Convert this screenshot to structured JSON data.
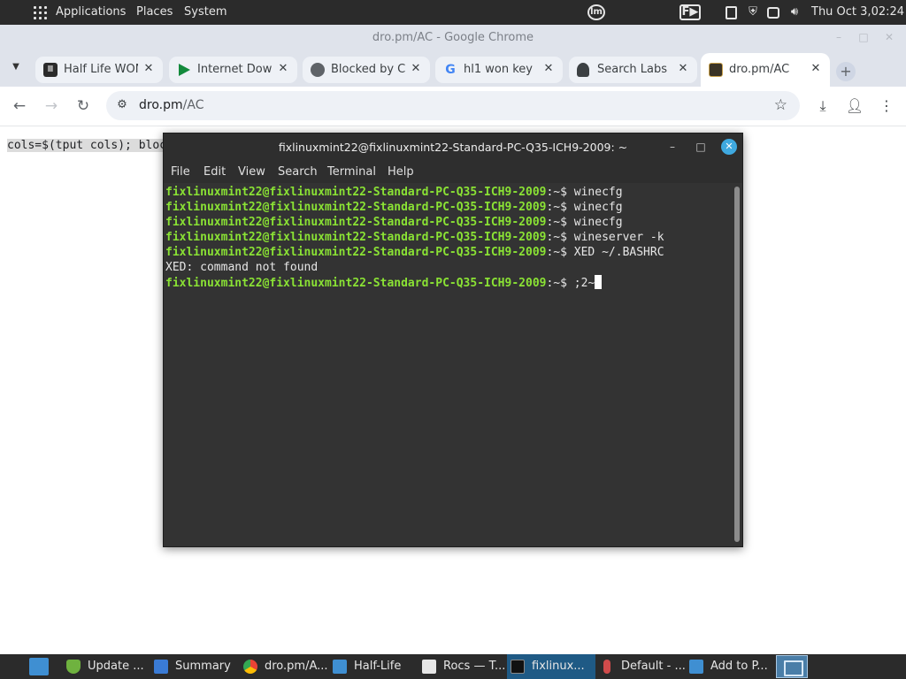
{
  "top_panel": {
    "menus": [
      "Applications",
      "Places",
      "System"
    ],
    "clock": "Thu Oct 3,02:24",
    "icons": [
      "apps-grid-icon",
      "mint-menu-icon",
      "focus-writer-icon",
      "clipboard-icon",
      "shield-icon",
      "window-icon",
      "volume-icon"
    ],
    "mint_glyph": "lm",
    "focus_glyph": "F▶"
  },
  "chrome": {
    "window_title": "dro.pm/AC - Google Chrome",
    "tabs": [
      {
        "title": "Half Life WON",
        "favicon": "hl-icon"
      },
      {
        "title": "Internet Down",
        "favicon": "play-icon"
      },
      {
        "title": "Blocked by C",
        "favicon": "globe-icon"
      },
      {
        "title": "hl1 won key",
        "favicon": "google-icon"
      },
      {
        "title": "Search Labs",
        "favicon": "flask-icon"
      },
      {
        "title": "dro.pm/AC",
        "favicon": "terminal-favicon-icon",
        "active": true
      }
    ],
    "address": {
      "host": "dro.pm",
      "path": "/AC"
    },
    "page_text": "cols=$(tput cols); bloc",
    "accent_color": "#1a73e8"
  },
  "terminal": {
    "title": "fixlinuxmint22@fixlinuxmint22-Standard-PC-Q35-ICH9-2009: ~",
    "menu": [
      "File",
      "Edit",
      "View",
      "Search",
      "Terminal",
      "Help"
    ],
    "prompt": "fixlinuxmint22@fixlinuxmint22-Standard-PC-Q35-ICH9-2009",
    "prompt_suffix": ":~$ ",
    "lines": [
      {
        "type": "cmd",
        "text": "winecfg"
      },
      {
        "type": "cmd",
        "text": "winecfg"
      },
      {
        "type": "cmd",
        "text": "winecfg"
      },
      {
        "type": "cmd",
        "text": "wineserver -k"
      },
      {
        "type": "cmd",
        "text": "XED ~/.BASHRC"
      },
      {
        "type": "out",
        "text": "XED: command not found"
      },
      {
        "type": "cmd",
        "text": ";2~"
      }
    ],
    "prompt_color": "#8ae234"
  },
  "taskbar": {
    "items": [
      {
        "label": "Update ...",
        "icon": "update-manager-icon"
      },
      {
        "label": "Summary",
        "icon": "download-icon"
      },
      {
        "label": "dro.pm/A...",
        "icon": "chrome-icon"
      },
      {
        "label": "Half-Life",
        "icon": "folder-icon"
      },
      {
        "label": "Rocs — T...",
        "icon": "document-icon"
      },
      {
        "label": "fixlinux...",
        "icon": "terminal-icon",
        "active": true
      },
      {
        "label": "Default - ...",
        "icon": "microphone-icon"
      },
      {
        "label": "Add to P...",
        "icon": "screen-icon"
      }
    ]
  }
}
